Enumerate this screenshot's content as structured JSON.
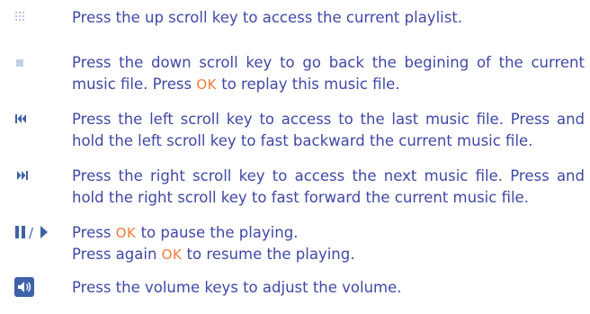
{
  "colors": {
    "text": "#4048a6",
    "ok_accent": "#f07a3a",
    "icon_blue": "#3d62a8",
    "icon_light": "#b9c8e3"
  },
  "ok_label": "OK",
  "instructions": [
    {
      "icon": "playlist-dots-icon",
      "text": "Press the up scroll key to access the current playlist."
    },
    {
      "icon": "stop-square-icon",
      "text_a": "Press the down scroll key to go back the begining of the current music file. Press ",
      "text_b": " to replay this music file."
    },
    {
      "icon": "rewind-icon",
      "text": "Press the left scroll key to access to the last music file. Press and hold the left scroll key to fast backward the current music file."
    },
    {
      "icon": "fast-forward-icon",
      "text": "Press the right scroll key to access the next music file. Press and hold the right scroll key to fast forward the current music file."
    },
    {
      "icon": "pause-play-icon",
      "icon_separator": "/",
      "line1_a": "Press ",
      "line1_b": " to pause the playing.",
      "line2_a": "Press again ",
      "line2_b": " to resume the playing."
    },
    {
      "icon": "volume-icon",
      "text": "Press the volume keys to adjust the volume."
    }
  ]
}
